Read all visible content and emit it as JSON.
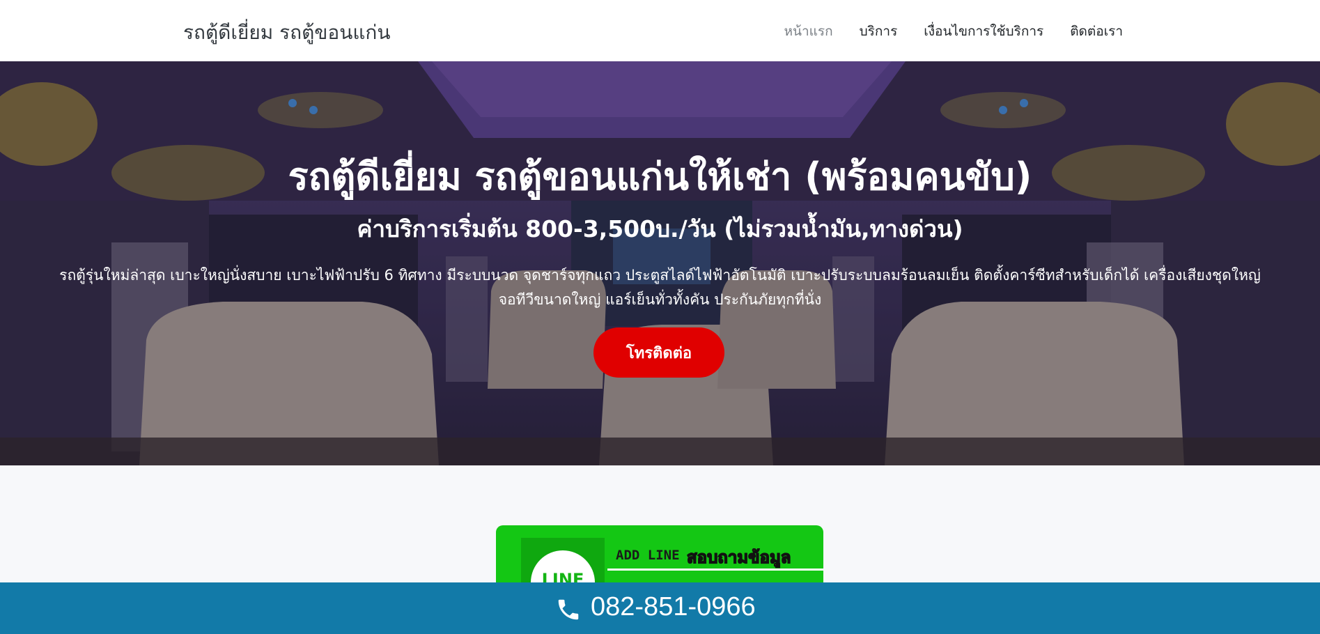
{
  "navbar": {
    "brand": "รถตู้ดีเยี่ยม รถตู้ขอนแก่น",
    "links": [
      "หน้าแรก",
      "บริการ",
      "เงื่อนไขการใช้บริการ",
      "ติดต่อเรา"
    ]
  },
  "hero": {
    "title": "รถตู้ดีเยี่ยม รถตู้ขอนแก่นให้เช่า (พร้อมคนขับ)",
    "subtitle": "ค่าบริการเริ่มต้น 800-3,500บ./วัน (ไม่รวมน้ำมัน,ทางด่วน)",
    "description_line1": "รถตู้รุ่นใหม่ล่าสุด เบาะใหญ่นั่งสบาย เบาะไฟฟ้าปรับ 6 ทิศทาง มีระบบนวด จุดชาร์จทุกแถว ประตูสไลด์ไฟฟ้าอัตโนมัติ เบาะปรับระบบลมร้อนลมเย็น ติดตั้งคาร์ซีทสำหรับเด็กได้ เครื่องเสียงชุดใหญ่",
    "description_line2": "จอทีวีขนาดใหญ่ แอร์เย็นทั่วทั้งคัน ประกันภัยทุกที่นั่ง",
    "cta_label": "โทรติดต่อ"
  },
  "line_card": {
    "logo_text": "LINE",
    "add_text": "ADD LINE :",
    "ask_text": "สอบถามข้อมูล"
  },
  "phone_bar": {
    "icon": "phone-icon",
    "number": "082-851-0966"
  },
  "colors": {
    "cta": "#e00000",
    "phone_bar": "#127aa8",
    "line_green": "#14c714"
  }
}
